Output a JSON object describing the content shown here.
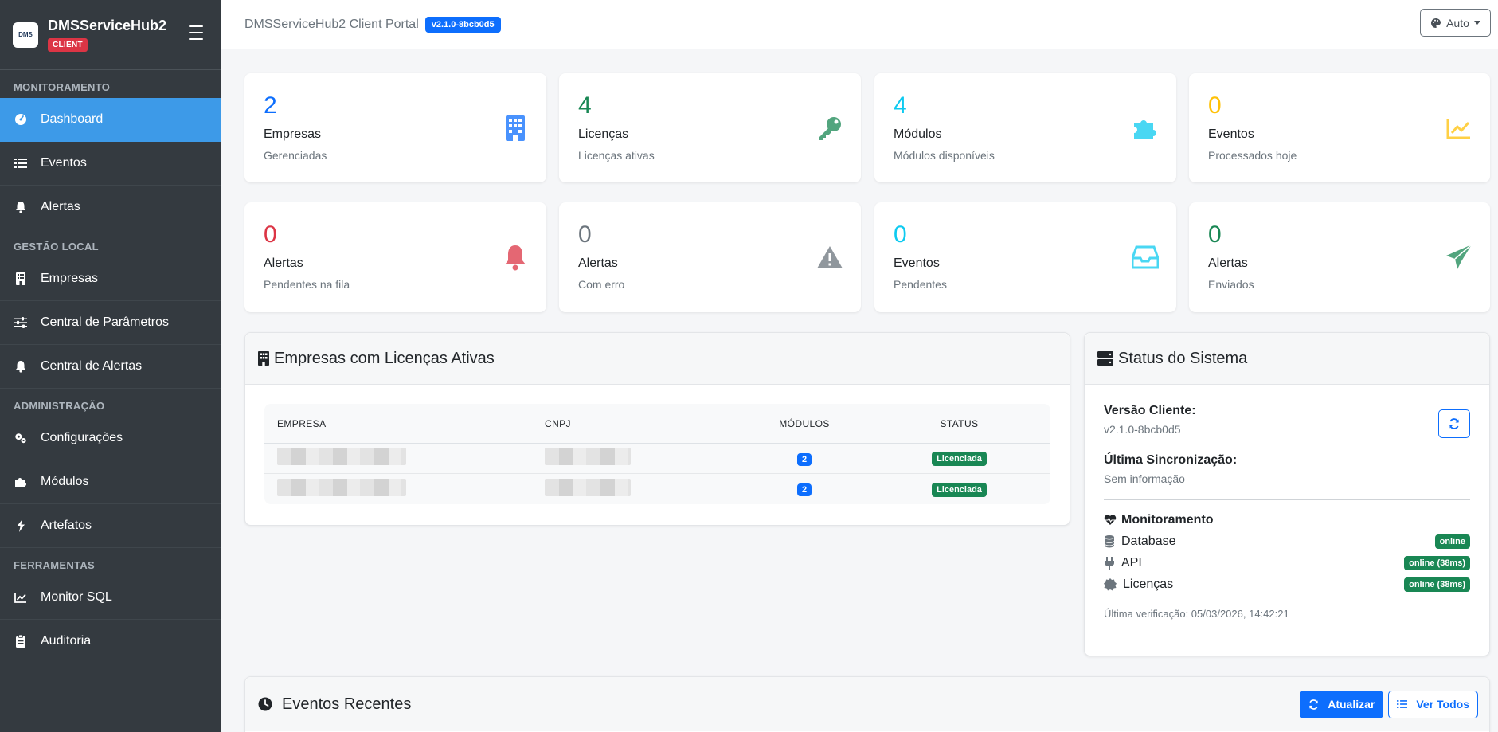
{
  "brand": {
    "name": "DMSServiceHub2",
    "badge": "CLIENT",
    "logo_text": "DMS"
  },
  "sidebar": {
    "sections": [
      {
        "title": "MONITORAMENTO",
        "items": [
          {
            "label": "Dashboard",
            "icon": "gauge-icon",
            "active": true
          },
          {
            "label": "Eventos",
            "icon": "list-icon"
          },
          {
            "label": "Alertas",
            "icon": "bell-icon"
          }
        ]
      },
      {
        "title": "GESTÃO LOCAL",
        "items": [
          {
            "label": "Empresas",
            "icon": "building-icon"
          },
          {
            "label": "Central de Parâmetros",
            "icon": "sliders-icon"
          },
          {
            "label": "Central de Alertas",
            "icon": "bell-icon"
          }
        ]
      },
      {
        "title": "ADMINISTRAÇÃO",
        "items": [
          {
            "label": "Configurações",
            "icon": "gears-icon"
          },
          {
            "label": "Módulos",
            "icon": "puzzle-icon"
          },
          {
            "label": "Artefatos",
            "icon": "bolt-icon"
          }
        ]
      },
      {
        "title": "FERRAMENTAS",
        "items": [
          {
            "label": "Monitor SQL",
            "icon": "chart-line-icon"
          },
          {
            "label": "Auditoria",
            "icon": "clipboard-icon"
          }
        ]
      }
    ]
  },
  "topbar": {
    "title": "DMSServiceHub2 Client Portal",
    "version": "v2.1.0-8bcb0d5",
    "theme": "Auto"
  },
  "stats": [
    {
      "value": "2",
      "label": "Empresas",
      "sub": "Gerenciadas",
      "color": "#0d6efd",
      "icon": "building-icon"
    },
    {
      "value": "4",
      "label": "Licenças",
      "sub": "Licenças ativas",
      "color": "#198754",
      "icon": "key-icon"
    },
    {
      "value": "4",
      "label": "Módulos",
      "sub": "Módulos disponíveis",
      "color": "#0dcaf0",
      "icon": "puzzle-icon"
    },
    {
      "value": "0",
      "label": "Eventos",
      "sub": "Processados hoje",
      "color": "#ffc107",
      "icon": "chart-line-icon"
    },
    {
      "value": "0",
      "label": "Alertas",
      "sub": "Pendentes na fila",
      "color": "#dc3545",
      "icon": "bell-icon"
    },
    {
      "value": "0",
      "label": "Alertas",
      "sub": "Com erro",
      "color": "#6c757d",
      "icon": "warning-icon"
    },
    {
      "value": "0",
      "label": "Eventos",
      "sub": "Pendentes",
      "color": "#0dcaf0",
      "icon": "inbox-icon"
    },
    {
      "value": "0",
      "label": "Alertas",
      "sub": "Enviados",
      "color": "#198754",
      "icon": "paper-plane-icon"
    }
  ],
  "companies": {
    "title": "Empresas com Licenças Ativas",
    "headers": {
      "empresa": "EMPRESA",
      "cnpj": "CNPJ",
      "modulos": "MÓDULOS",
      "status": "STATUS"
    },
    "rows": [
      {
        "modulos": "2",
        "status": "Licenciada"
      },
      {
        "modulos": "2",
        "status": "Licenciada"
      }
    ]
  },
  "system": {
    "title": "Status do Sistema",
    "version_label": "Versão Cliente:",
    "version_value": "v2.1.0-8bcb0d5",
    "sync_label": "Última Sincronização:",
    "sync_value": "Sem informação",
    "monitor_title": "Monitoramento",
    "services": [
      {
        "name": "Database",
        "status": "online",
        "icon": "database-icon"
      },
      {
        "name": "API",
        "status": "online (38ms)",
        "icon": "plug-icon"
      },
      {
        "name": "Licenças",
        "status": "online (38ms)",
        "icon": "certificate-icon"
      }
    ],
    "last_check": "Última verificação: 05/03/2026, 14:42:21"
  },
  "recent": {
    "title": "Eventos Recentes",
    "refresh_label": "Atualizar",
    "view_all_label": "Ver Todos"
  }
}
